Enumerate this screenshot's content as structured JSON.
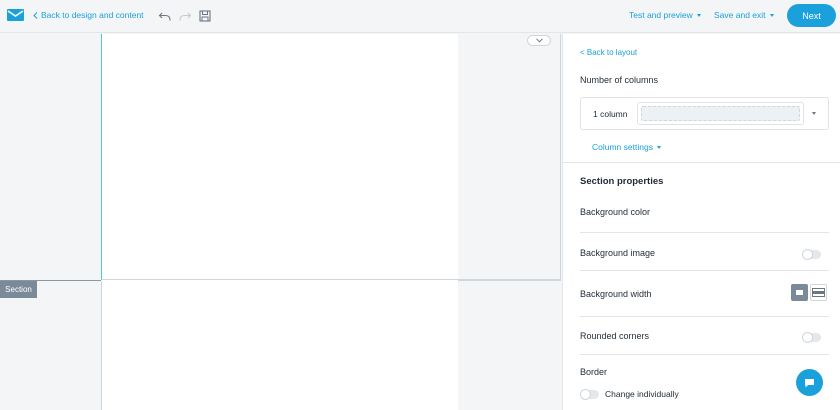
{
  "topbar": {
    "back_label": "Back to design and content",
    "test_preview_label": "Test and preview",
    "save_exit_label": "Save and exit",
    "next_label": "Next"
  },
  "canvas": {
    "section_tag": "Section"
  },
  "panel": {
    "back_to_layout": "< Back to layout",
    "num_columns_label": "Number of columns",
    "columns_value": "1 column",
    "column_settings_label": "Column settings",
    "section_properties_title": "Section properties",
    "background_color_label": "Background color",
    "background_image_label": "Background image",
    "background_width_label": "Background width",
    "rounded_corners_label": "Rounded corners",
    "border_label": "Border",
    "change_individually_label": "Change individually"
  },
  "colors": {
    "accent": "#1aa1dc",
    "section_tag": "#7b8a98",
    "section_guide": "#53c9c0"
  },
  "icons": [
    "envelope-logo-icon",
    "undo-icon",
    "redo-icon",
    "save-icon",
    "chevron-down-icon",
    "chat-icon"
  ]
}
